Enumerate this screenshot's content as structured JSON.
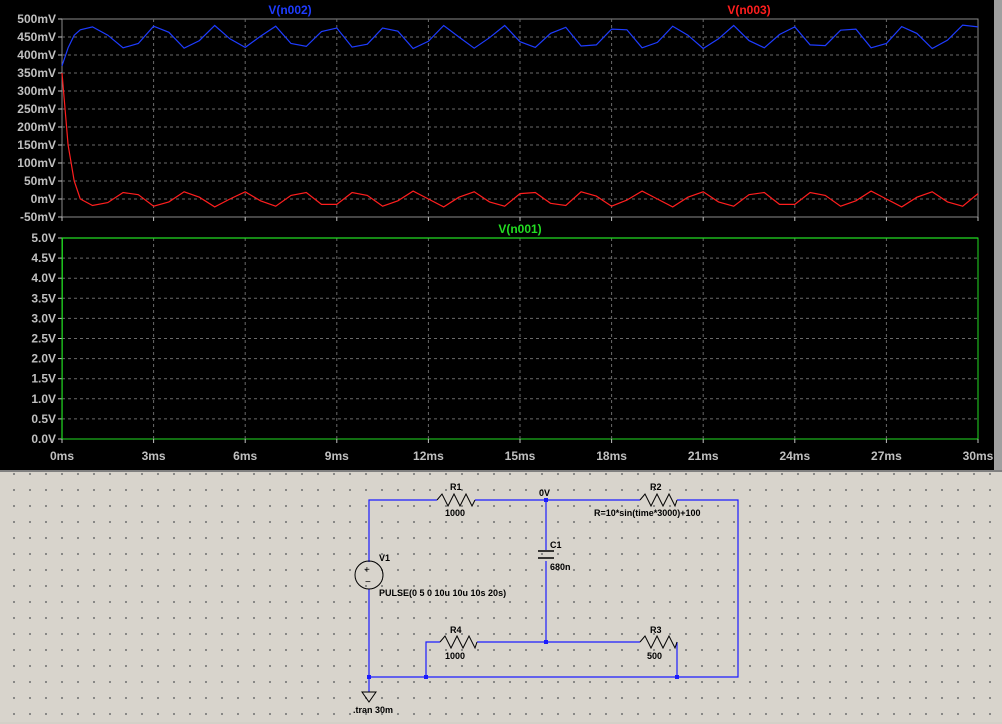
{
  "colors": {
    "trace_n002": "#1e3cff",
    "trace_n003": "#ff1e1e",
    "trace_n001": "#22dd22",
    "axis_text": "#c0c0c0",
    "grid": "#6a6a6a",
    "wire": "#1c1cff"
  },
  "plot_top": {
    "traces": [
      {
        "label": "V(n002)",
        "color": "#1e3cff"
      },
      {
        "label": "V(n003)",
        "color": "#ff1e1e"
      }
    ],
    "y_ticks": [
      "500mV",
      "450mV",
      "400mV",
      "350mV",
      "300mV",
      "250mV",
      "200mV",
      "150mV",
      "100mV",
      "50mV",
      "0mV",
      "-50mV"
    ]
  },
  "plot_bottom": {
    "traces": [
      {
        "label": "V(n001)",
        "color": "#22dd22"
      }
    ],
    "y_ticks": [
      "5.0V",
      "4.5V",
      "4.0V",
      "3.5V",
      "3.0V",
      "2.5V",
      "2.0V",
      "1.5V",
      "1.0V",
      "0.5V",
      "0.0V"
    ]
  },
  "x_ticks": [
    "0ms",
    "3ms",
    "6ms",
    "9ms",
    "12ms",
    "15ms",
    "18ms",
    "21ms",
    "24ms",
    "27ms",
    "30ms"
  ],
  "chart_data": [
    {
      "type": "line",
      "xlim": [
        0,
        30
      ],
      "ylim": [
        -50,
        500
      ],
      "series": [
        {
          "name": "V(n002)",
          "x": [
            0,
            0.2,
            0.4,
            0.6,
            1,
            1.5,
            2,
            2.5,
            3,
            3.5,
            4,
            4.5,
            5,
            5.5,
            6,
            6.5,
            7,
            7.5,
            8,
            8.5,
            9,
            9.5,
            10,
            10.5,
            11,
            11.5,
            12,
            12.5,
            13,
            13.5,
            14,
            14.5,
            15,
            15.5,
            16,
            16.5,
            17,
            17.5,
            18,
            18.5,
            19,
            19.5,
            20,
            20.5,
            21,
            21.5,
            22,
            22.5,
            23,
            23.5,
            24,
            24.5,
            25,
            25.5,
            26,
            26.5,
            27,
            27.5,
            28,
            28.5,
            29,
            29.5,
            30
          ],
          "y": [
            370,
            420,
            455,
            470,
            478,
            455,
            420,
            432,
            480,
            463,
            419,
            440,
            482,
            445,
            421,
            452,
            480,
            432,
            424,
            465,
            475,
            422,
            430,
            475,
            466,
            418,
            438,
            482,
            450,
            419,
            448,
            482,
            437,
            421,
            460,
            477,
            425,
            428,
            472,
            470,
            420,
            435,
            480,
            455,
            418,
            445,
            482,
            440,
            420,
            457,
            478,
            428,
            426,
            469,
            472,
            420,
            432,
            479,
            460,
            418,
            441,
            483,
            478
          ]
        },
        {
          "name": "V(n003)",
          "x": [
            0,
            0.2,
            0.4,
            0.6,
            1,
            1.5,
            2,
            2.5,
            3,
            3.5,
            4,
            4.5,
            5,
            5.5,
            6,
            6.5,
            7,
            7.5,
            8,
            8.5,
            9,
            9.5,
            10,
            10.5,
            11,
            11.5,
            12,
            12.5,
            13,
            13.5,
            14,
            14.5,
            15,
            15.5,
            16,
            16.5,
            17,
            17.5,
            18,
            18.5,
            19,
            19.5,
            20,
            20.5,
            21,
            21.5,
            22,
            22.5,
            23,
            23.5,
            24,
            24.5,
            25,
            25.5,
            26,
            26.5,
            27,
            27.5,
            28,
            28.5,
            29,
            29.5,
            30
          ],
          "y": [
            350,
            150,
            50,
            0,
            -18,
            -10,
            18,
            12,
            -20,
            -8,
            20,
            5,
            -22,
            0,
            20,
            -5,
            -20,
            10,
            18,
            -15,
            -15,
            18,
            10,
            -20,
            -5,
            22,
            0,
            -22,
            5,
            20,
            -8,
            -20,
            15,
            18,
            -12,
            -18,
            20,
            8,
            -20,
            -3,
            22,
            0,
            -22,
            5,
            20,
            -8,
            -20,
            12,
            18,
            -15,
            -15,
            18,
            10,
            -20,
            -5,
            22,
            0,
            -22,
            5,
            20,
            -8,
            -20,
            15
          ]
        }
      ]
    },
    {
      "type": "line",
      "xlim": [
        0,
        30
      ],
      "ylim": [
        0,
        5
      ],
      "series": [
        {
          "name": "V(n001)",
          "x": [
            0,
            0.01,
            30
          ],
          "y": [
            0,
            5,
            5
          ]
        }
      ]
    }
  ],
  "schematic": {
    "node_label": "0V",
    "components": [
      {
        "ref": "R1",
        "value": "1000"
      },
      {
        "ref": "R2",
        "value": "R=10*sin(time*3000)+100"
      },
      {
        "ref": "C1",
        "value": "680n"
      },
      {
        "ref": "V1",
        "value": "PULSE(0 5 0 10u 10u 10s 20s)"
      },
      {
        "ref": "R4",
        "value": "1000"
      },
      {
        "ref": "R3",
        "value": "500"
      }
    ],
    "directive": ".tran 30m"
  }
}
